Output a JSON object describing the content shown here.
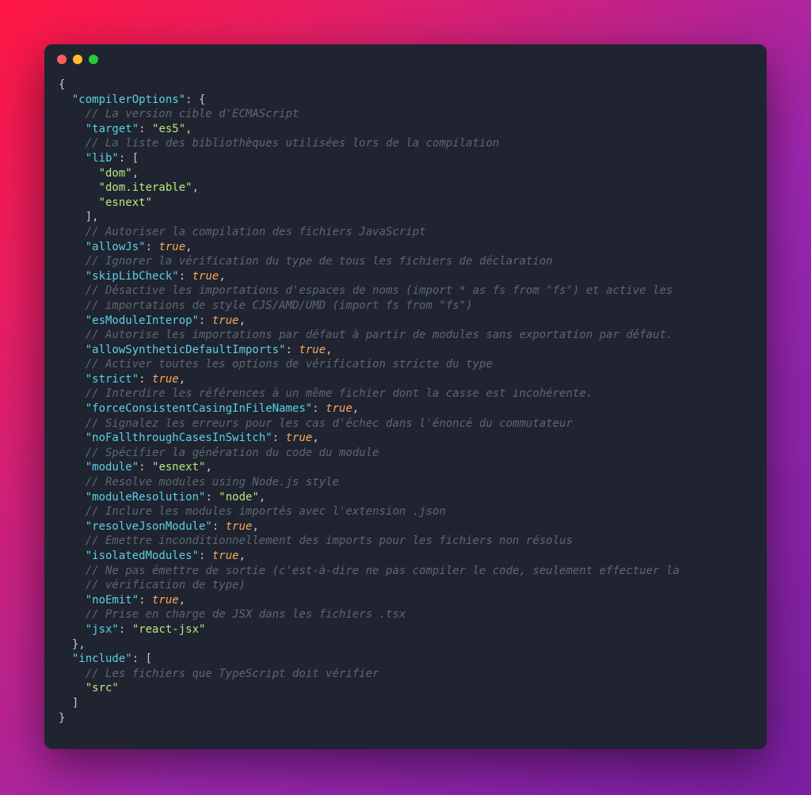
{
  "code": {
    "l1": "{",
    "l2_key": "\"compilerOptions\"",
    "l2_p": ": {",
    "l3_c": "// La version cible d'ECMAScript",
    "l4_key": "\"target\"",
    "l4_p": ": ",
    "l4_val": "\"es5\"",
    "l4_end": ",",
    "l5_c": "// La liste des bibliothèques utilisées lors de la compilation",
    "l6_key": "\"lib\"",
    "l6_p": ": [",
    "l7_val": "\"dom\"",
    "l7_end": ",",
    "l8_val": "\"dom.iterable\"",
    "l8_end": ",",
    "l9_val": "\"esnext\"",
    "l10": "],",
    "l11_c": "// Autoriser la compilation des fichiers JavaScript",
    "l12_key": "\"allowJs\"",
    "l12_p": ": ",
    "l12_val": "true",
    "l12_end": ",",
    "l13_c": "// Ignorer la vérification du type de tous les fichiers de déclaration",
    "l14_key": "\"skipLibCheck\"",
    "l14_p": ": ",
    "l14_val": "true",
    "l14_end": ",",
    "l15_c": "// Désactive les importations d'espaces de noms (import * as fs from \"fs\") et active les",
    "l16_c": "// importations de style CJS/AMD/UMD (import fs from \"fs\")",
    "l17_key": "\"esModuleInterop\"",
    "l17_p": ": ",
    "l17_val": "true",
    "l17_end": ",",
    "l18_c": "// Autorise les importations par défaut à partir de modules sans exportation par défaut.",
    "l19_key": "\"allowSyntheticDefaultImports\"",
    "l19_p": ": ",
    "l19_val": "true",
    "l19_end": ",",
    "l20_c": "// Activer toutes les options de vérification stricte du type",
    "l21_key": "\"strict\"",
    "l21_p": ": ",
    "l21_val": "true",
    "l21_end": ",",
    "l22_c": "// Interdire les références à un même fichier dont la casse est incohérente.",
    "l23_key": "\"forceConsistentCasingInFileNames\"",
    "l23_p": ": ",
    "l23_val": "true",
    "l23_end": ",",
    "l24_c": "// Signalez les erreurs pour les cas d'échec dans l'énoncé du commutateur",
    "l25_key": "\"noFallthroughCasesInSwitch\"",
    "l25_p": ": ",
    "l25_val": "true",
    "l25_end": ",",
    "l26_c": "// Spécifier la génération du code du module",
    "l27_key": "\"module\"",
    "l27_p": ": ",
    "l27_val": "\"esnext\"",
    "l27_end": ",",
    "l28_c": "// Resolve modules using Node.js style",
    "l29_key": "\"moduleResolution\"",
    "l29_p": ": ",
    "l29_val": "\"node\"",
    "l29_end": ",",
    "l30_c": "// Inclure les modules importés avec l'extension .json",
    "l31_key": "\"resolveJsonModule\"",
    "l31_p": ": ",
    "l31_val": "true",
    "l31_end": ",",
    "l32_c": "// Emettre inconditionnellement des imports pour les fichiers non résolus",
    "l33_key": "\"isolatedModules\"",
    "l33_p": ": ",
    "l33_val": "true",
    "l33_end": ",",
    "l34_c": "// Ne pas émettre de sortie (c'est-à-dire ne pas compiler le code, seulement effectuer la",
    "l35_c": "// vérification de type)",
    "l36_key": "\"noEmit\"",
    "l36_p": ": ",
    "l36_val": "true",
    "l36_end": ",",
    "l37_c": "// Prise en charge de JSX dans les fichiers .tsx",
    "l38_key": "\"jsx\"",
    "l38_p": ": ",
    "l38_val": "\"react-jsx\"",
    "l39": "},",
    "l40_key": "\"include\"",
    "l40_p": ": [",
    "l41_c": "// Les fichiers que TypeScript doit vérifier",
    "l42_val": "\"src\"",
    "l43": "]",
    "l44": "}"
  }
}
